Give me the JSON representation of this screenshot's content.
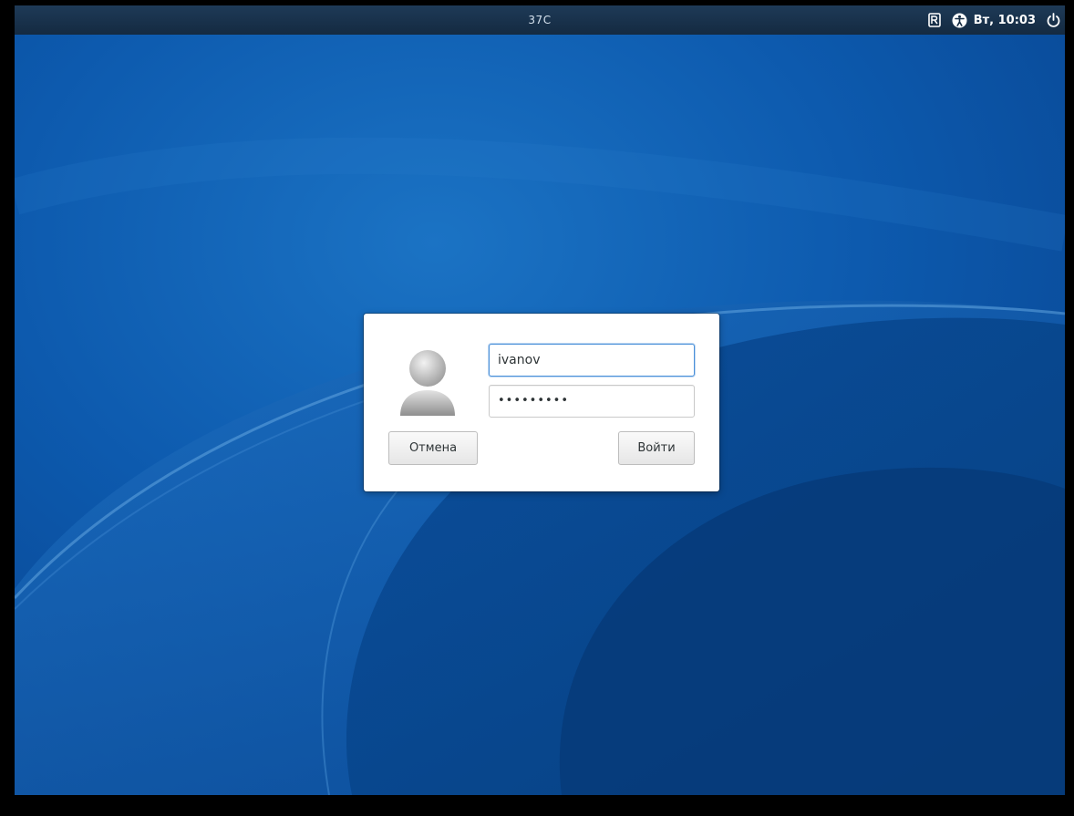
{
  "topbar": {
    "center_label": "37C",
    "clock": "Вт, 10:03",
    "icons": [
      "keyboard-layout-icon",
      "accessibility-icon",
      "power-icon"
    ]
  },
  "login_dialog": {
    "username_value": "ivanov",
    "password_value": "•••••••••",
    "cancel_label": "Отмена",
    "login_label": "Войти"
  },
  "colors": {
    "topbar": "#1b3550",
    "wallpaper_blue": "#0a4e9c",
    "focus_border": "#4a90d9",
    "dialog_bg": "#ffffff"
  }
}
